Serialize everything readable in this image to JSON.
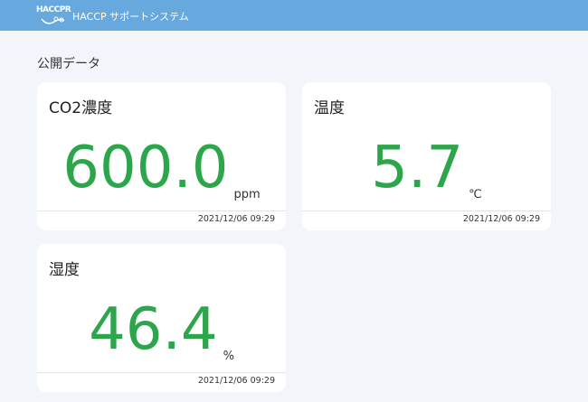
{
  "header": {
    "logo_text": "HACCPR",
    "title": "HACCP サポートシステム",
    "background": "#67a8df"
  },
  "section": {
    "title": "公開データ"
  },
  "cards": [
    {
      "title": "CO2濃度",
      "value": "600.0",
      "unit": "ppm",
      "timestamp": "2021/12/06 09:29"
    },
    {
      "title": "温度",
      "value": "5.7",
      "unit": "℃",
      "timestamp": "2021/12/06 09:29"
    },
    {
      "title": "湿度",
      "value": "46.4",
      "unit": "%",
      "timestamp": "2021/12/06 09:29"
    }
  ],
  "colors": {
    "value": "#2da64b",
    "page_background": "#f2f5f9",
    "card_background": "#ffffff"
  }
}
